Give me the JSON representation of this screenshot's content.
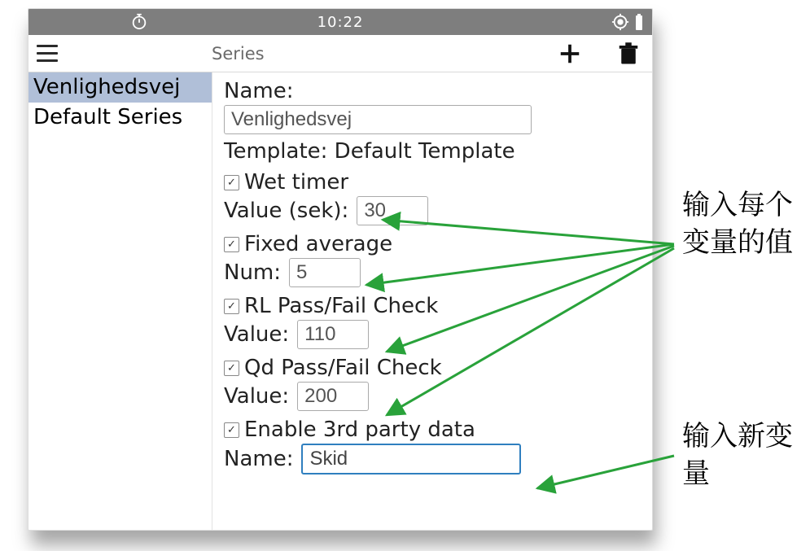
{
  "statusbar": {
    "time": "10:22"
  },
  "toolbar": {
    "title": "Series",
    "menu_icon": "menu-icon",
    "add_icon": "plus-icon",
    "delete_icon": "trash-icon"
  },
  "sidebar": {
    "items": [
      {
        "label": "Venlighedsvej",
        "selected": true
      },
      {
        "label": "Default Series",
        "selected": false
      }
    ]
  },
  "form": {
    "name_label": "Name:",
    "name_value": "Venlighedsvej",
    "template_label": "Template:",
    "template_value": "Default Template",
    "wet_timer": {
      "checked": true,
      "label": "Wet timer",
      "value_label": "Value (sek):",
      "value": "30"
    },
    "fixed_average": {
      "checked": true,
      "label": "Fixed average",
      "value_label": "Num:",
      "value": "5"
    },
    "rl_check": {
      "checked": true,
      "label": "RL Pass/Fail Check",
      "value_label": "Value:",
      "value": "110"
    },
    "qd_check": {
      "checked": true,
      "label": "Qd Pass/Fail Check",
      "value_label": "Value:",
      "value": "200"
    },
    "third_party": {
      "checked": true,
      "label": "Enable 3rd party data",
      "value_label": "Name:",
      "value": "Skid"
    }
  },
  "annotations": {
    "values": "输入每个变量的值",
    "new_variable": "输入新变量"
  },
  "colors": {
    "arrow": "#29a23a"
  }
}
